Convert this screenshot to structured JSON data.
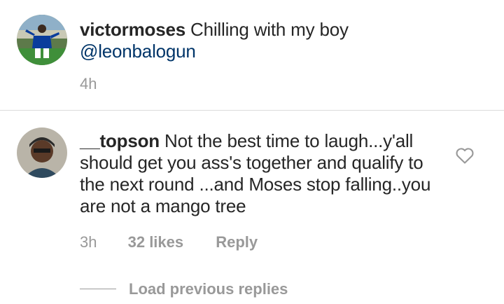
{
  "post": {
    "username": "victormoses",
    "caption_text": "Chilling with my boy",
    "mention": "@leonbalogun",
    "time": "4h"
  },
  "comment": {
    "username": "__topson",
    "text": "Not the best time to laugh...y'all should get you ass's together and  qualify to the next round ...and Moses stop falling..you are not a mango tree",
    "time": "3h",
    "likes": "32 likes",
    "reply_label": "Reply",
    "like_icon": "heart-outline-icon"
  },
  "replies": {
    "load_label": "Load previous replies"
  },
  "colors": {
    "text": "#262626",
    "secondary": "#999999",
    "mention": "#003569",
    "divider": "#dbdbdb"
  }
}
